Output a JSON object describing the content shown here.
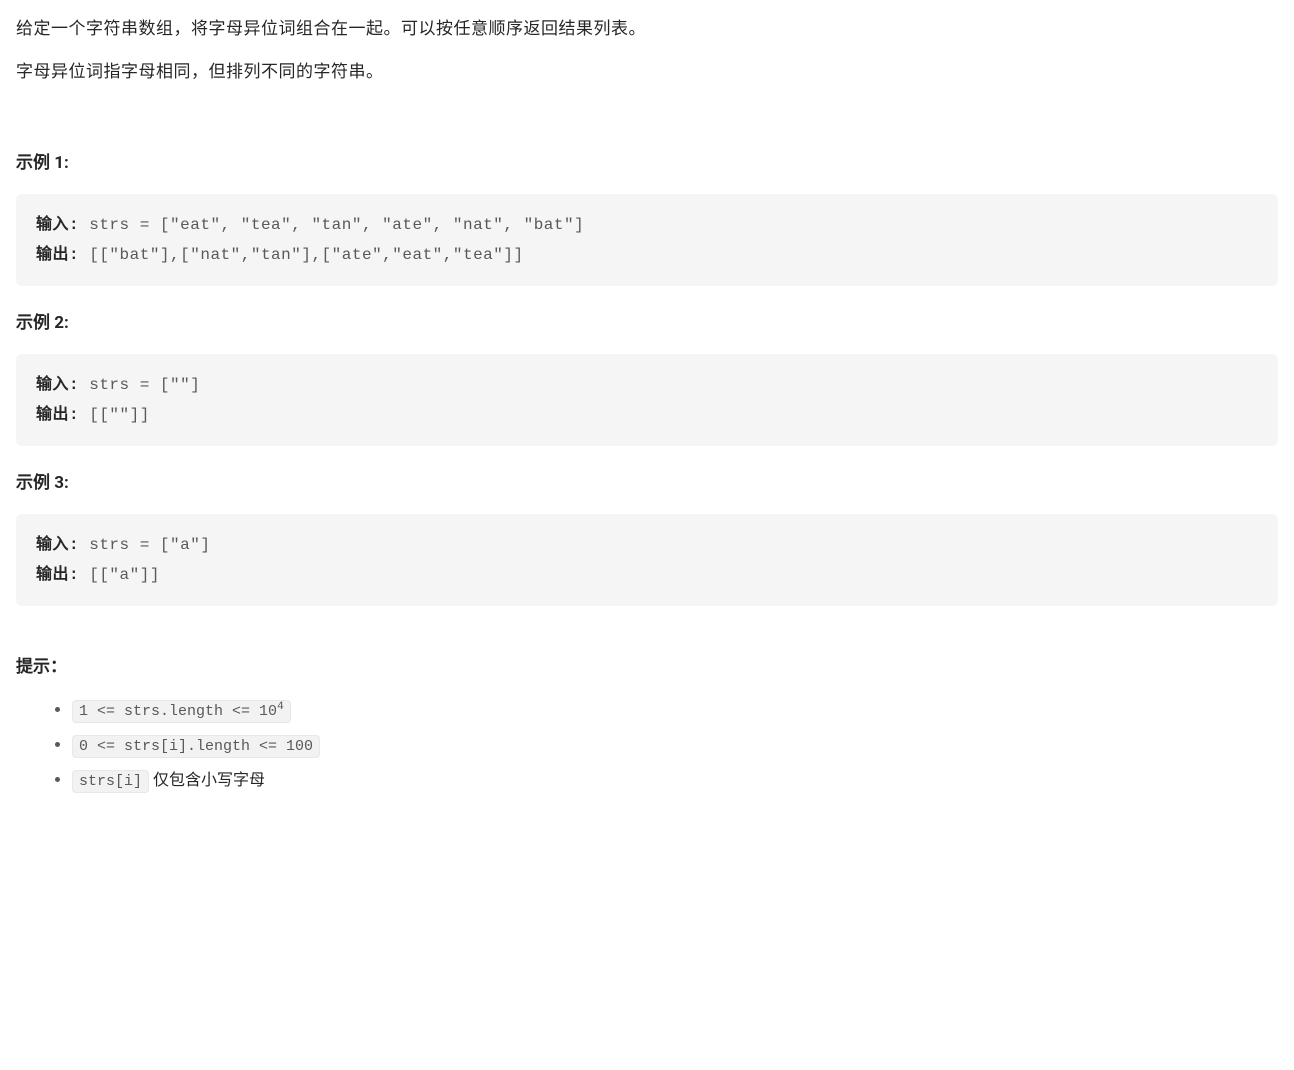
{
  "description": {
    "p1": "给定一个字符串数组，将字母异位词组合在一起。可以按任意顺序返回结果列表。",
    "p2": "字母异位词指字母相同，但排列不同的字符串。"
  },
  "examples": [
    {
      "title": "示例 1:",
      "input_label": "输入: ",
      "input_value": "strs = [\"eat\", \"tea\", \"tan\", \"ate\", \"nat\", \"bat\"]",
      "output_label": "输出: ",
      "output_value": "[[\"bat\"],[\"nat\",\"tan\"],[\"ate\",\"eat\",\"tea\"]]"
    },
    {
      "title": "示例 2:",
      "input_label": "输入: ",
      "input_value": "strs = [\"\"]",
      "output_label": "输出: ",
      "output_value": "[[\"\"]]"
    },
    {
      "title": "示例 3:",
      "input_label": "输入: ",
      "input_value": "strs = [\"a\"]",
      "output_label": "输出: ",
      "output_value": "[[\"a\"]]"
    }
  ],
  "hints": {
    "title": "提示：",
    "items": [
      {
        "code_prefix": "1 <= strs.length <= 10",
        "sup": "4",
        "suffix": ""
      },
      {
        "code_prefix": "0 <= strs[i].length <= 100",
        "sup": "",
        "suffix": ""
      },
      {
        "code_prefix": "strs[i]",
        "sup": "",
        "suffix": " 仅包含小写字母"
      }
    ]
  }
}
